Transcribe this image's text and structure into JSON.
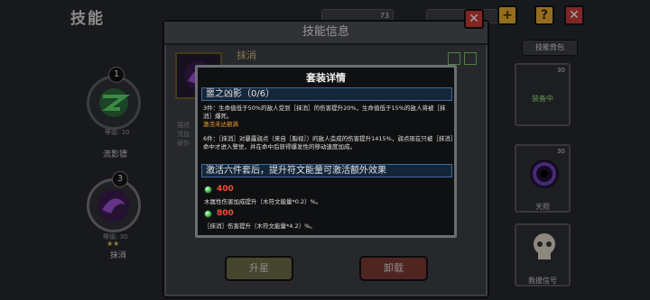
{
  "background": {
    "title": "技能",
    "resource_1": "73",
    "resource_2": "",
    "skills": [
      {
        "index": "1",
        "level": "等级: 10",
        "name": "流影镖"
      },
      {
        "index": "3",
        "level": "等级: 30",
        "name": "抹消"
      }
    ],
    "skill_bag_label": "技能背包",
    "cards": [
      {
        "level": "30",
        "label": "装备中"
      },
      {
        "level": "30",
        "label": "天照"
      },
      {
        "level": "",
        "label": "救援信号"
      }
    ]
  },
  "panel": {
    "title": "技能信息",
    "skill_name": "抹消",
    "partial_texts": [
      "描述",
      "流血",
      "破伤"
    ],
    "upgrade_label": "升星",
    "unload_label": "卸载"
  },
  "popup": {
    "title": "套装详情",
    "set_name": "噩之凶影（0/6）",
    "tier3_text": "3件：生命值低于50%的敌人受到［抹消］的伤害提升20%，生命值低于15%的敌人将被［抹消］爆死。",
    "tier3_status": "激活未达额满",
    "tier6_text": "6件：［抹消］对暴露弱点（来自［脂视］）的敌人造成的伤害提升1415%，弱点现在只被［抹消］命中才进入警觉，并在命中后获得爆发性的移动速度加成。",
    "bonus_header": "激活六件套后，提升符文能量可激活额外效果",
    "bonuses": [
      {
        "threshold": "400",
        "effect": "木属性伤害加成提升（木符文能量*0.2）%。"
      },
      {
        "threshold": "800",
        "effect": "［抹消］伤害提升（木符文能量*4.2）%。"
      }
    ]
  },
  "colors": {
    "close_button": "#c6393a",
    "help_button": "#e3a92e",
    "bar_border": "#3e6d9c",
    "threshold_red": "#ff4a3a",
    "status_orange": "#f29b32"
  }
}
